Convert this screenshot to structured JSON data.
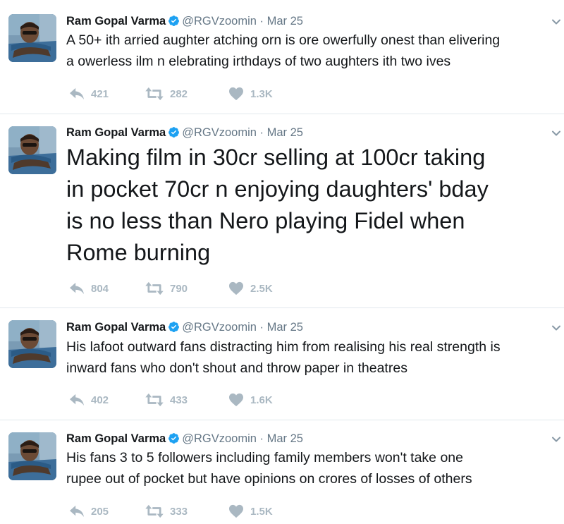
{
  "tweets": [
    {
      "author": "Ram Gopal Varma",
      "handle": "@RGVzoomin",
      "separator": "·",
      "date": "Mar 25",
      "text_lines": [
        "A 50+ ith arried aughter atching orn is ore owerfully onest than elivering",
        "a owerless ilm n elebrating irthdays of two aughters ith two ives"
      ],
      "replies": "421",
      "retweets": "282",
      "likes": "1.3K"
    },
    {
      "author": "Ram Gopal Varma",
      "handle": "@RGVzoomin",
      "separator": "·",
      "date": "Mar 25",
      "text_lines": [
        "Making film in 30cr selling at 100cr taking",
        "in pocket 70cr n enjoying daughters' bday",
        "is no less than Nero playing Fidel when",
        "Rome burning"
      ],
      "replies": "804",
      "retweets": "790",
      "likes": "2.5K"
    },
    {
      "author": "Ram Gopal Varma",
      "handle": "@RGVzoomin",
      "separator": "·",
      "date": "Mar 25",
      "text_lines": [
        "His lafoot outward fans distracting him from realising his real strength is",
        "inward fans who don't shout and throw paper in theatres"
      ],
      "replies": "402",
      "retweets": "433",
      "likes": "1.6K"
    },
    {
      "author": "Ram Gopal Varma",
      "handle": "@RGVzoomin",
      "separator": "·",
      "date": "Mar 25",
      "text_lines": [
        "His fans 3 to 5 followers including family members won't  take one",
        "rupee out of pocket but have opinions on crores of losses of others"
      ],
      "replies": "205",
      "retweets": "333",
      "likes": "1.5K"
    }
  ],
  "icons": {
    "reply": "reply-icon",
    "retweet": "retweet-icon",
    "like": "heart-icon",
    "verified": "verified-badge-icon",
    "more": "chevron-down-icon"
  },
  "colors": {
    "text": "#14171a",
    "muted": "#657786",
    "action": "#aab8c2",
    "verified": "#1da1f2",
    "divider": "#e1e8ed"
  }
}
